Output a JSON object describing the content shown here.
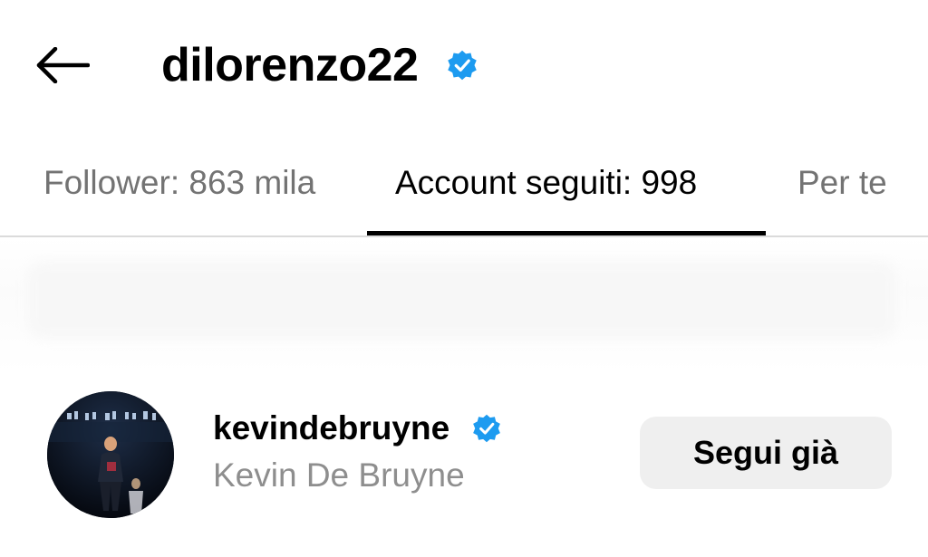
{
  "header": {
    "back_icon": "arrow-left-icon",
    "username": "dilorenzo22",
    "verified_icon": "verified-badge-icon",
    "verified_color": "#1d9bf0"
  },
  "tabs": [
    {
      "label": "Follower: 863 mila",
      "active": false
    },
    {
      "label": "Account seguiti: 998",
      "active": true
    },
    {
      "label": "Per te",
      "active": false
    }
  ],
  "list": [
    {
      "avatar_icon": "profile-photo-avatar",
      "username": "kevindebruyne",
      "verified": true,
      "full_name": "Kevin De Bruyne",
      "button_label": "Segui già"
    }
  ]
}
